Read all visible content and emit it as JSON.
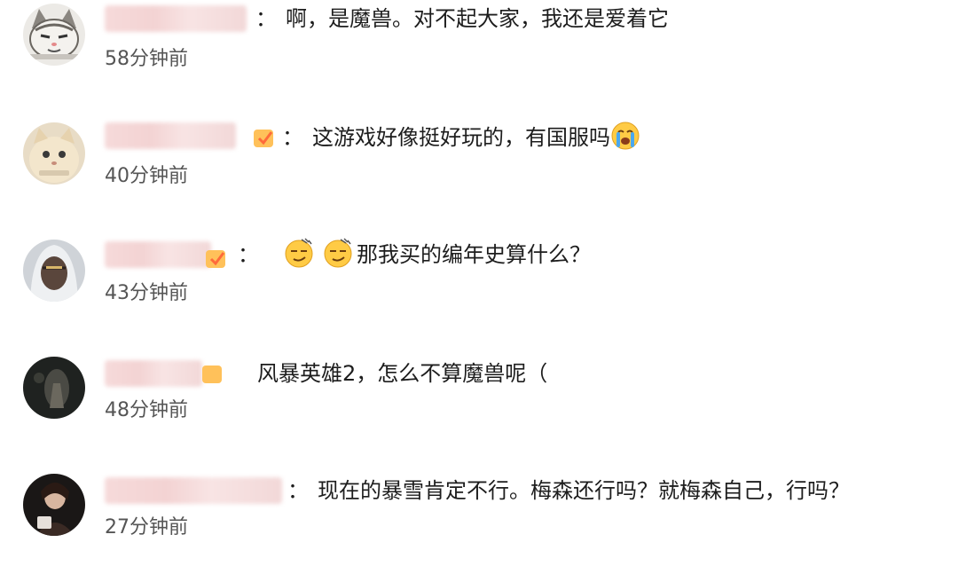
{
  "comments": [
    {
      "separator": "：",
      "text": "啊，是魔兽。对不起大家，我还是爱着它",
      "time": "58分钟前",
      "avatar": "cat-cartoon-avatar"
    },
    {
      "separator": "：",
      "text": "这游戏好像挺好玩的，有国服吗",
      "time": "40分钟前",
      "avatar": "cat-photo-avatar",
      "emoji": "crying-face-emoji"
    },
    {
      "separator": "：",
      "text": "那我买的编年史算什么？",
      "time": "43分钟前",
      "avatar": "hooded-character-avatar",
      "emoji": "smug-face-emoji"
    },
    {
      "separator": "",
      "text": "风暴英雄2，怎么不算魔兽呢（",
      "time": "48分钟前",
      "avatar": "dark-scene-avatar"
    },
    {
      "separator": "：",
      "text": "现在的暴雪肯定不行。梅森还行吗？就梅森自己，行吗？",
      "time": "27分钟前",
      "avatar": "woman-portrait-avatar"
    }
  ]
}
